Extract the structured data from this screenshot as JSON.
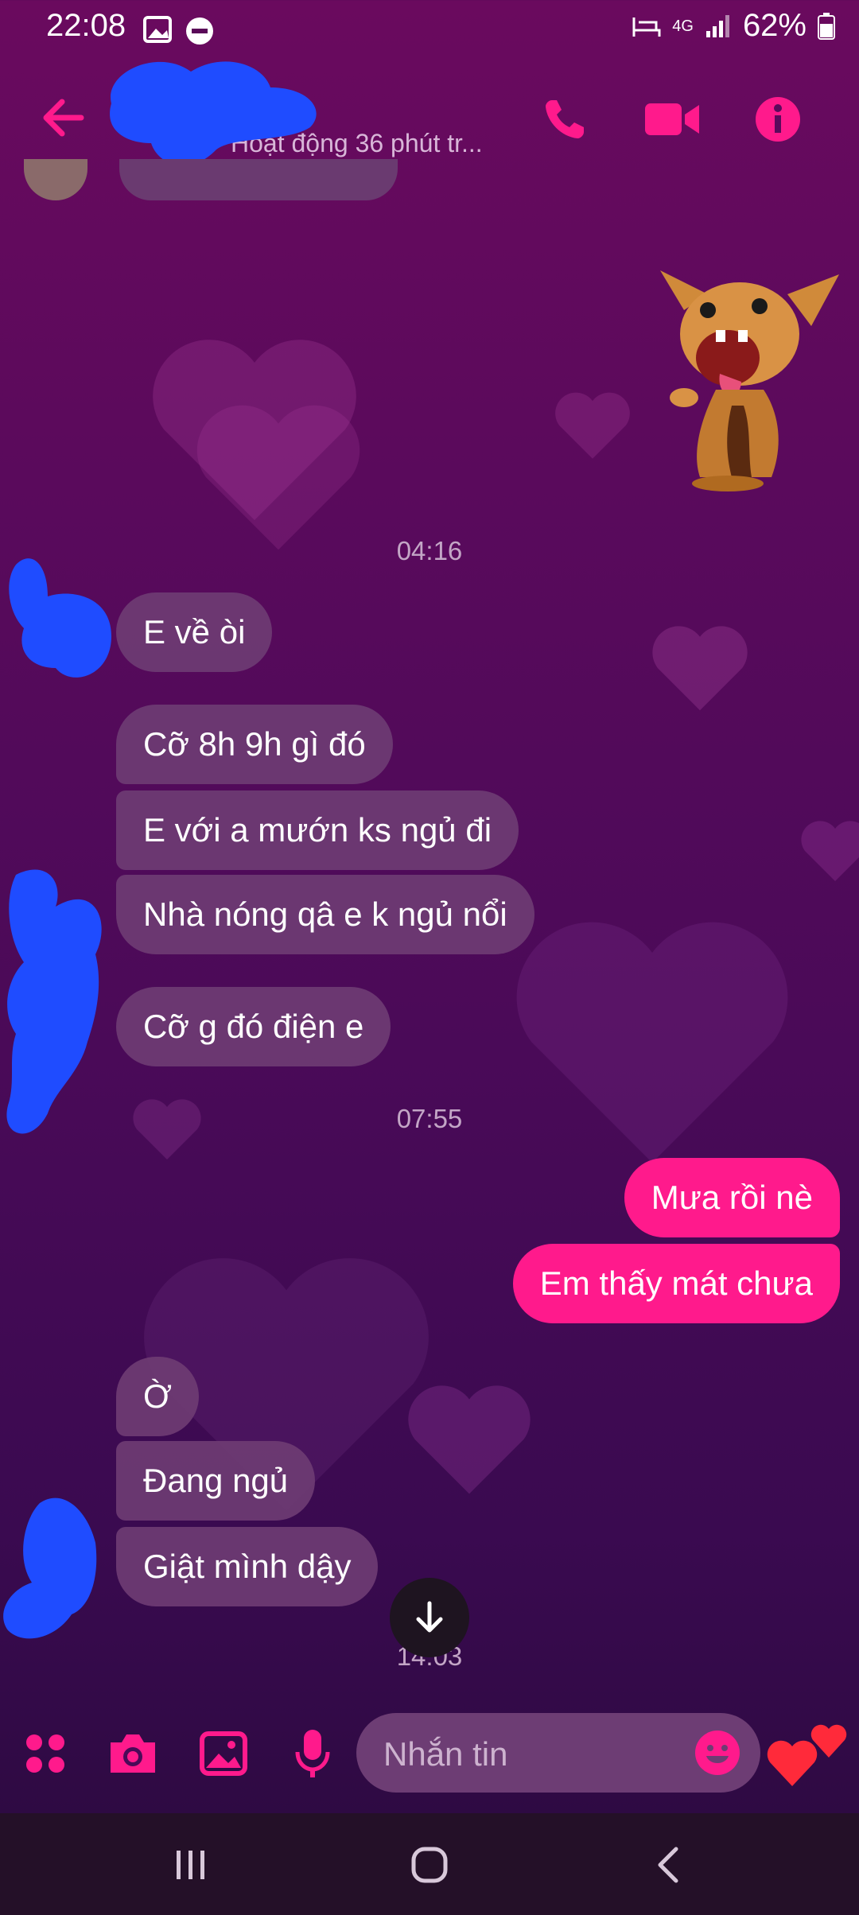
{
  "status_bar": {
    "time": "22:08",
    "battery": "62%",
    "network": "4G"
  },
  "header": {
    "subtitle": "Hoạt động 36 phút tr..."
  },
  "icons": {
    "back": "back-arrow-icon",
    "call": "phone-icon",
    "video": "video-camera-icon",
    "info": "info-icon"
  },
  "conversation": {
    "timestamps": [
      "04:16",
      "07:55",
      "14:03"
    ],
    "group1": [
      "E về òi"
    ],
    "group2": [
      "Cỡ 8h 9h gì đó",
      "E với a mướn ks ngủ đi",
      "Nhà nóng qâ e k ngủ nổi"
    ],
    "group3": [
      "Cỡ g đó điện e"
    ],
    "sent": [
      "Mưa rồi nè",
      "Em thấy mát chưa"
    ],
    "group4": [
      "Ờ",
      "Đang ngủ",
      "Giật mình dậy"
    ]
  },
  "composer": {
    "placeholder": "Nhắn tin"
  },
  "colors": {
    "accent": "#ff1a8c",
    "received_bubble": "#6e3c73",
    "background_top": "#6a0a5e",
    "background_bottom": "#2a0a3e",
    "redaction_blue": "#1f4cff"
  }
}
